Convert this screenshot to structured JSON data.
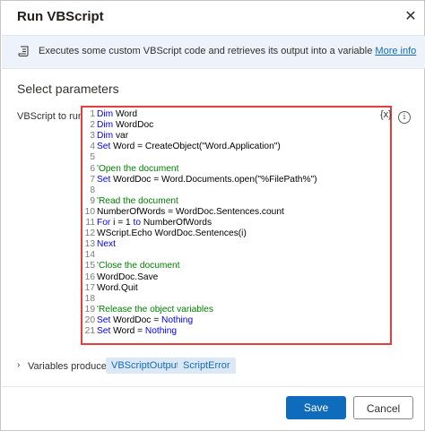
{
  "dialog": {
    "title": "Run VBScript",
    "close_glyph": "✕"
  },
  "banner": {
    "text": "Executes some custom VBScript code and retrieves its output into a variable ",
    "link": "More info"
  },
  "section": {
    "title": "Select parameters"
  },
  "field": {
    "label": "VBScript to run:",
    "variable_button": "{x}",
    "info_glyph": "i"
  },
  "code": [
    {
      "n": "1",
      "parts": [
        [
          "kw",
          "Dim"
        ],
        [
          "tx",
          " Word"
        ]
      ]
    },
    {
      "n": "2",
      "parts": [
        [
          "kw",
          "Dim"
        ],
        [
          "tx",
          " WordDoc"
        ]
      ]
    },
    {
      "n": "3",
      "parts": [
        [
          "kw",
          "Dim"
        ],
        [
          "tx",
          " var"
        ]
      ]
    },
    {
      "n": "4",
      "parts": [
        [
          "kw",
          "Set"
        ],
        [
          "tx",
          " Word = CreateObject(\"Word.Application\")"
        ]
      ]
    },
    {
      "n": "5",
      "parts": []
    },
    {
      "n": "6",
      "parts": [
        [
          "cm",
          "'Open the document"
        ]
      ]
    },
    {
      "n": "7",
      "parts": [
        [
          "kw",
          "Set"
        ],
        [
          "tx",
          " WordDoc = Word.Documents.open(\"%FilePath%\")"
        ]
      ]
    },
    {
      "n": "8",
      "parts": []
    },
    {
      "n": "9",
      "parts": [
        [
          "cm",
          "'Read the document"
        ]
      ]
    },
    {
      "n": "10",
      "parts": [
        [
          "tx",
          "NumberOfWords = WordDoc.Sentences.count"
        ]
      ]
    },
    {
      "n": "11",
      "parts": [
        [
          "kw",
          "For"
        ],
        [
          "tx",
          " i = 1 "
        ],
        [
          "kw",
          "to"
        ],
        [
          "tx",
          " NumberOfWords"
        ]
      ]
    },
    {
      "n": "12",
      "parts": [
        [
          "tx",
          "WScript.Echo WordDoc.Sentences(i)"
        ]
      ]
    },
    {
      "n": "13",
      "parts": [
        [
          "kw",
          "Next"
        ]
      ]
    },
    {
      "n": "14",
      "parts": []
    },
    {
      "n": "15",
      "parts": [
        [
          "cm",
          "'Close the document"
        ]
      ]
    },
    {
      "n": "16",
      "parts": [
        [
          "tx",
          "WordDoc.Save"
        ]
      ]
    },
    {
      "n": "17",
      "parts": [
        [
          "tx",
          "Word.Quit"
        ]
      ]
    },
    {
      "n": "18",
      "parts": []
    },
    {
      "n": "19",
      "parts": [
        [
          "cm",
          "'Release the object variables"
        ]
      ]
    },
    {
      "n": "20",
      "parts": [
        [
          "kw",
          "Set"
        ],
        [
          "tx",
          " WordDoc = "
        ],
        [
          "kw",
          "Nothing"
        ]
      ]
    },
    {
      "n": "21",
      "parts": [
        [
          "kw",
          "Set"
        ],
        [
          "tx",
          " Word = "
        ],
        [
          "kw",
          "Nothing"
        ]
      ]
    }
  ],
  "variables": {
    "chevron": "›",
    "label": "Variables produced",
    "chips": [
      "VBScriptOutput",
      "ScriptError"
    ]
  },
  "footer": {
    "save_label": "Save",
    "cancel_label": "Cancel"
  },
  "colors": {
    "accent": "#0f6cbd",
    "highlight_border": "#e53e3e",
    "keyword": "#0000ff",
    "comment": "#008000"
  },
  "icons": {
    "banner": "script-scroll-icon",
    "close": "close-icon",
    "info": "info-icon",
    "expand": "chevron-right-icon"
  }
}
